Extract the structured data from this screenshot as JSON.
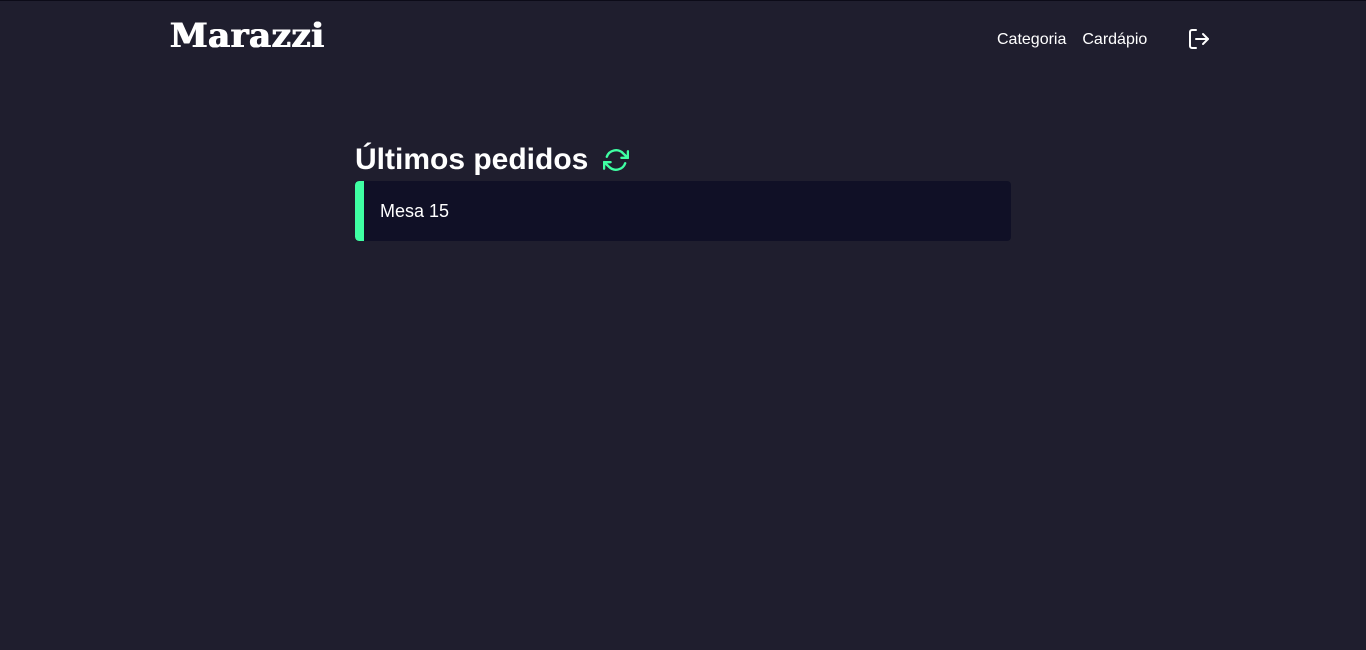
{
  "header": {
    "logo": "Marazzi",
    "nav": [
      {
        "label": "Categoria"
      },
      {
        "label": "Cardápio"
      }
    ],
    "logout_icon": "logout-icon"
  },
  "main": {
    "title": "Últimos pedidos",
    "refresh_icon": "refresh-icon",
    "orders": [
      {
        "label": "Mesa 15"
      }
    ]
  },
  "colors": {
    "background": "#1f1e2e",
    "card": "#101026",
    "accent": "#3fffa3",
    "text": "#ffffff"
  }
}
